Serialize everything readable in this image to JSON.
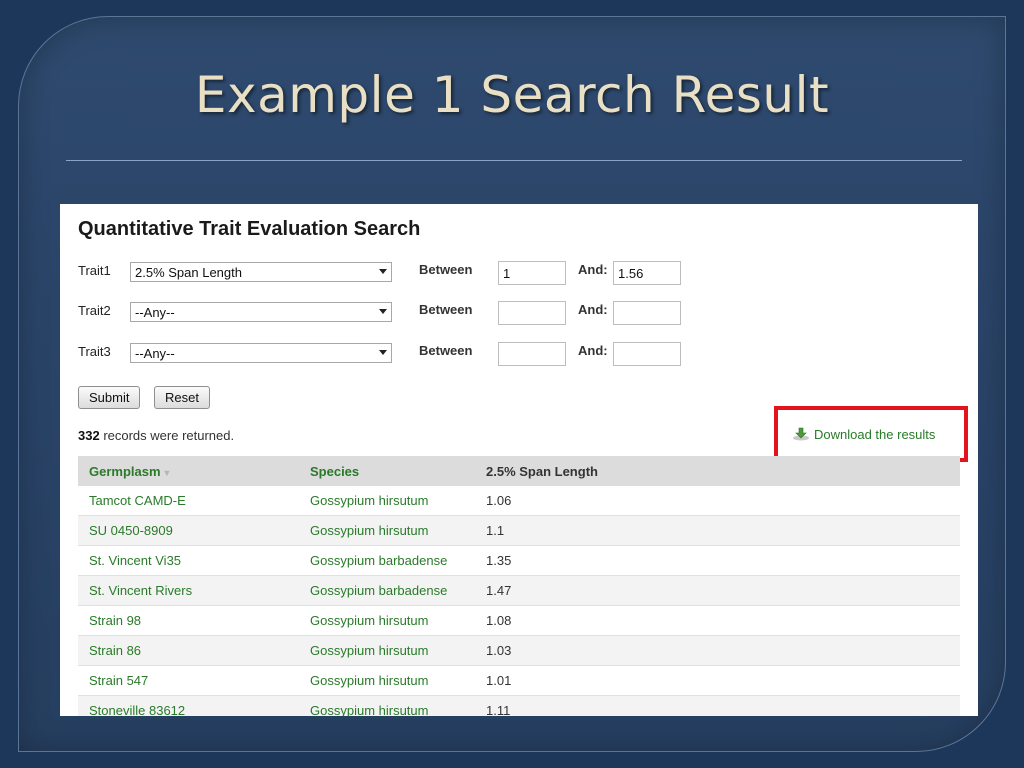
{
  "slide": {
    "title": "Example 1 Search Result"
  },
  "form": {
    "heading": "Quantitative Trait Evaluation Search",
    "traits": [
      {
        "label": "Trait1",
        "selected": "2.5% Span Length",
        "between_label": "Between",
        "and_label": "And:",
        "min_value": "1",
        "max_value": "1.56"
      },
      {
        "label": "Trait2",
        "selected": "--Any--",
        "between_label": "Between",
        "and_label": "And:",
        "min_value": "",
        "max_value": ""
      },
      {
        "label": "Trait3",
        "selected": "--Any--",
        "between_label": "Between",
        "and_label": "And:",
        "min_value": "",
        "max_value": ""
      }
    ],
    "submit_label": "Submit",
    "reset_label": "Reset"
  },
  "results": {
    "count": "332",
    "count_suffix": " records were returned.",
    "download_label": "Download the results",
    "highlight_color": "#e3141b",
    "columns": {
      "germplasm": "Germplasm",
      "species": "Species",
      "span": "2.5% Span Length"
    },
    "rows": [
      {
        "germplasm": "Tamcot CAMD-E",
        "species": "Gossypium hirsutum",
        "span": "1.06"
      },
      {
        "germplasm": "SU 0450-8909",
        "species": "Gossypium hirsutum",
        "span": "1.1"
      },
      {
        "germplasm": "St. Vincent Vi35",
        "species": "Gossypium barbadense",
        "span": "1.35"
      },
      {
        "germplasm": "St. Vincent Rivers",
        "species": "Gossypium barbadense",
        "span": "1.47"
      },
      {
        "germplasm": "Strain 98",
        "species": "Gossypium hirsutum",
        "span": "1.08"
      },
      {
        "germplasm": "Strain 86",
        "species": "Gossypium hirsutum",
        "span": "1.03"
      },
      {
        "germplasm": "Strain 547",
        "species": "Gossypium hirsutum",
        "span": "1.01"
      },
      {
        "germplasm": "Stoneville 83612",
        "species": "Gossypium hirsutum",
        "span": "1.11"
      }
    ]
  }
}
